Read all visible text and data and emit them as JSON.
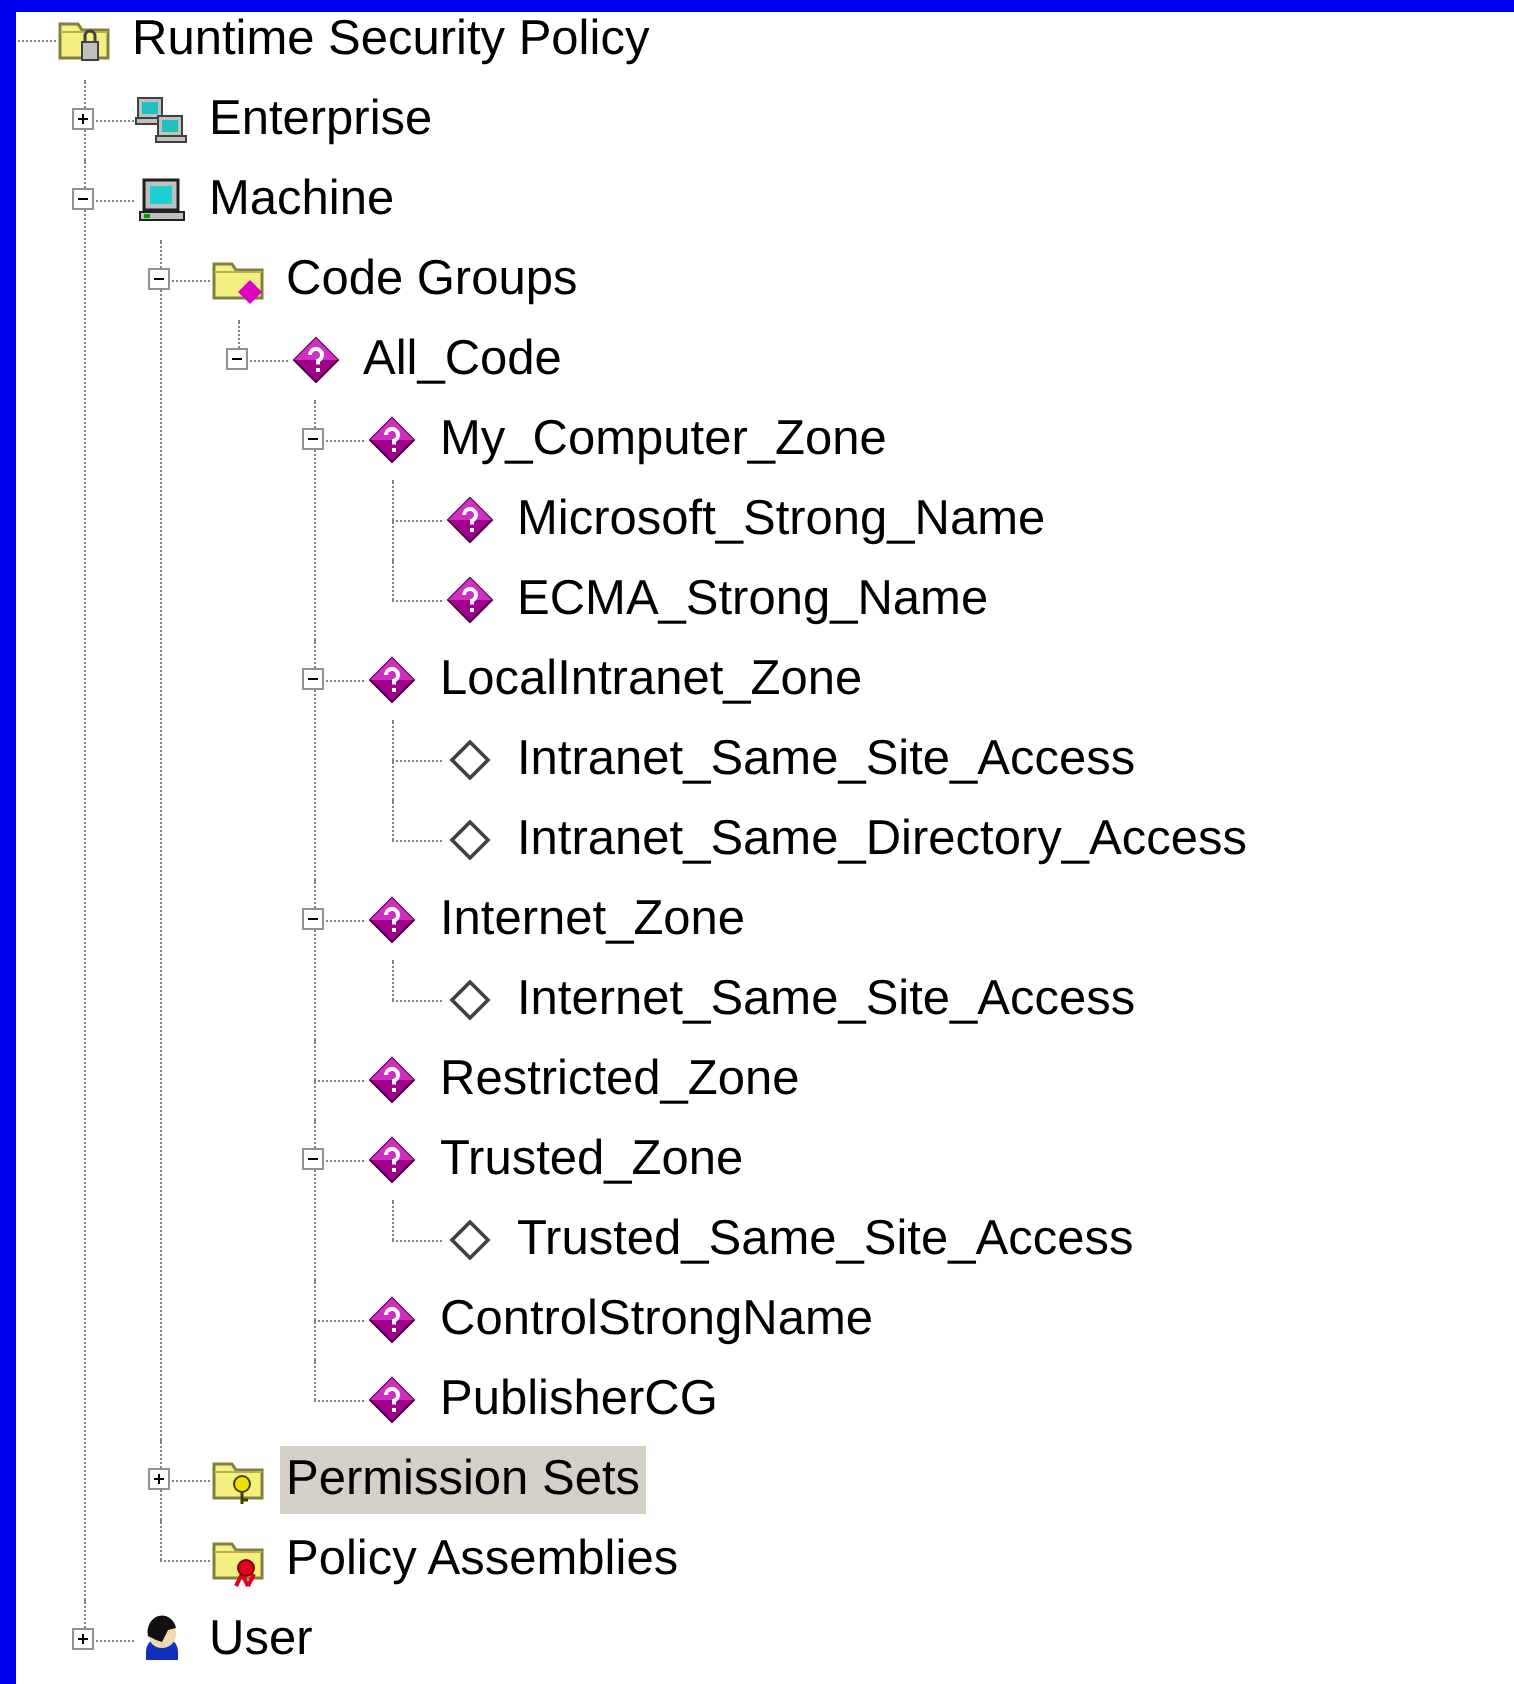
{
  "tree": [
    {
      "label": "Runtime Security Policy",
      "kind": "secure-folder",
      "selected": false,
      "children": [
        {
          "label": "Enterprise",
          "kind": "computers",
          "selected": false,
          "expanded": false
        },
        {
          "label": "Machine",
          "kind": "computer",
          "selected": false,
          "expanded": true,
          "children": [
            {
              "label": "Code Groups",
              "kind": "group-folder",
              "selected": false,
              "expanded": true,
              "children": [
                {
                  "label": "All_Code",
                  "kind": "code-group",
                  "selected": false,
                  "expanded": true,
                  "children": [
                    {
                      "label": "My_Computer_Zone",
                      "kind": "code-group",
                      "selected": false,
                      "expanded": true,
                      "children": [
                        {
                          "label": "Microsoft_Strong_Name",
                          "kind": "code-group",
                          "selected": false
                        },
                        {
                          "label": "ECMA_Strong_Name",
                          "kind": "code-group",
                          "selected": false
                        }
                      ]
                    },
                    {
                      "label": "LocalIntranet_Zone",
                      "kind": "code-group",
                      "selected": false,
                      "expanded": true,
                      "children": [
                        {
                          "label": "Intranet_Same_Site_Access",
                          "kind": "empty-group",
                          "selected": false
                        },
                        {
                          "label": "Intranet_Same_Directory_Access",
                          "kind": "empty-group",
                          "selected": false
                        }
                      ]
                    },
                    {
                      "label": "Internet_Zone",
                      "kind": "code-group",
                      "selected": false,
                      "expanded": true,
                      "children": [
                        {
                          "label": "Internet_Same_Site_Access",
                          "kind": "empty-group",
                          "selected": false
                        }
                      ]
                    },
                    {
                      "label": "Restricted_Zone",
                      "kind": "code-group",
                      "selected": false
                    },
                    {
                      "label": "Trusted_Zone",
                      "kind": "code-group",
                      "selected": false,
                      "expanded": true,
                      "children": [
                        {
                          "label": "Trusted_Same_Site_Access",
                          "kind": "empty-group",
                          "selected": false
                        }
                      ]
                    },
                    {
                      "label": "ControlStrongName",
                      "kind": "code-group",
                      "selected": false
                    },
                    {
                      "label": "PublisherCG",
                      "kind": "code-group",
                      "selected": false
                    }
                  ]
                }
              ]
            },
            {
              "label": "Permission Sets",
              "kind": "key-folder",
              "selected": true,
              "expanded": false
            },
            {
              "label": "Policy Assemblies",
              "kind": "ribbon-folder",
              "selected": false
            }
          ]
        },
        {
          "label": "User",
          "kind": "user",
          "selected": false,
          "expanded": false
        }
      ]
    }
  ]
}
